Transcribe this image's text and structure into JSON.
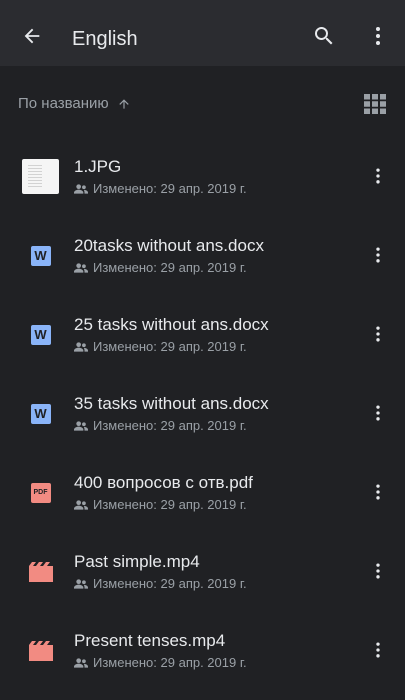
{
  "header": {
    "title": "English",
    "back_icon": "arrow-back-icon",
    "search_icon": "search-icon",
    "overflow_icon": "more-vert-icon"
  },
  "sort": {
    "label": "По названию",
    "direction_icon": "arrow-up-icon",
    "view_toggle_icon": "grid-view-icon"
  },
  "colors": {
    "background": "#202124",
    "topbar": "#2b2c30",
    "text_primary": "#e8eaed",
    "text_secondary": "#9aa0a6",
    "word_blue": "#8ab4f8",
    "pdf_red": "#f28b82",
    "video_red": "#f28b82"
  },
  "files": [
    {
      "name": "1.JPG",
      "type": "image",
      "meta": "Изменено: 29 апр. 2019 г.",
      "shared_icon": "people-icon"
    },
    {
      "name": "20tasks without ans.docx",
      "type": "word",
      "icon_letter": "W",
      "meta": "Изменено: 29 апр. 2019 г.",
      "shared_icon": "people-icon"
    },
    {
      "name": "25 tasks without ans.docx",
      "type": "word",
      "icon_letter": "W",
      "meta": "Изменено: 29 апр. 2019 г.",
      "shared_icon": "people-icon"
    },
    {
      "name": "35 tasks without ans.docx",
      "type": "word",
      "icon_letter": "W",
      "meta": "Изменено: 29 апр. 2019 г.",
      "shared_icon": "people-icon"
    },
    {
      "name": "400 вопросов с отв.pdf",
      "type": "pdf",
      "icon_letter": "PDF",
      "meta": "Изменено: 29 апр. 2019 г.",
      "shared_icon": "people-icon"
    },
    {
      "name": "Past simple.mp4",
      "type": "video",
      "meta": "Изменено: 29 апр. 2019 г.",
      "shared_icon": "people-icon"
    },
    {
      "name": "Present tenses.mp4",
      "type": "video",
      "meta": "Изменено: 29 апр. 2019 г.",
      "shared_icon": "people-icon"
    }
  ]
}
